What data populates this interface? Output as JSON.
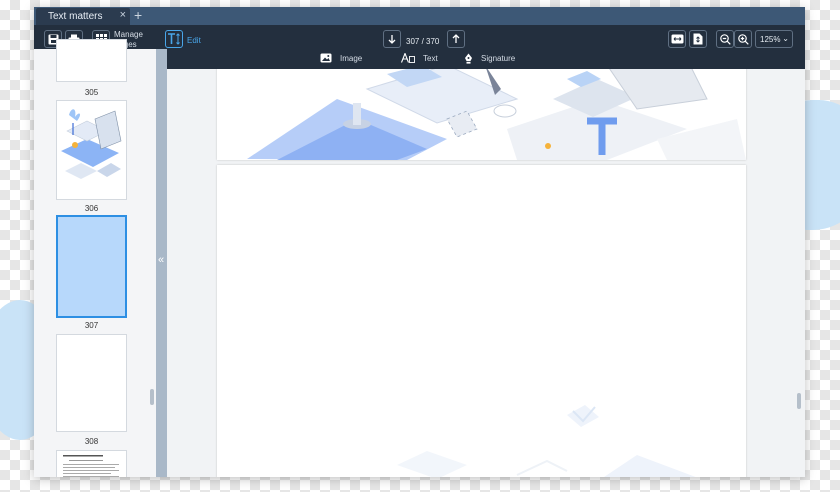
{
  "tab": {
    "title": "Text matters",
    "close": "×",
    "add": "+"
  },
  "toolbar": {
    "manage_pages_line1": "Manage",
    "manage_pages_line2": "Pages",
    "edit_label": "Edit",
    "page_counter": "307 / 370",
    "zoom_value": "125%"
  },
  "insert_bar": {
    "image_label": "Image",
    "text_label": "Text",
    "signature_label": "Signature"
  },
  "thumbnails": [
    {
      "number": "305"
    },
    {
      "number": "306"
    },
    {
      "number": "307"
    },
    {
      "number": "308"
    }
  ],
  "current_page": 307,
  "colors": {
    "toolbar": "#232f3e",
    "tabbar": "#3d5876",
    "accent": "#2d8fe3",
    "selected_thumb": "#b7d8fb"
  }
}
